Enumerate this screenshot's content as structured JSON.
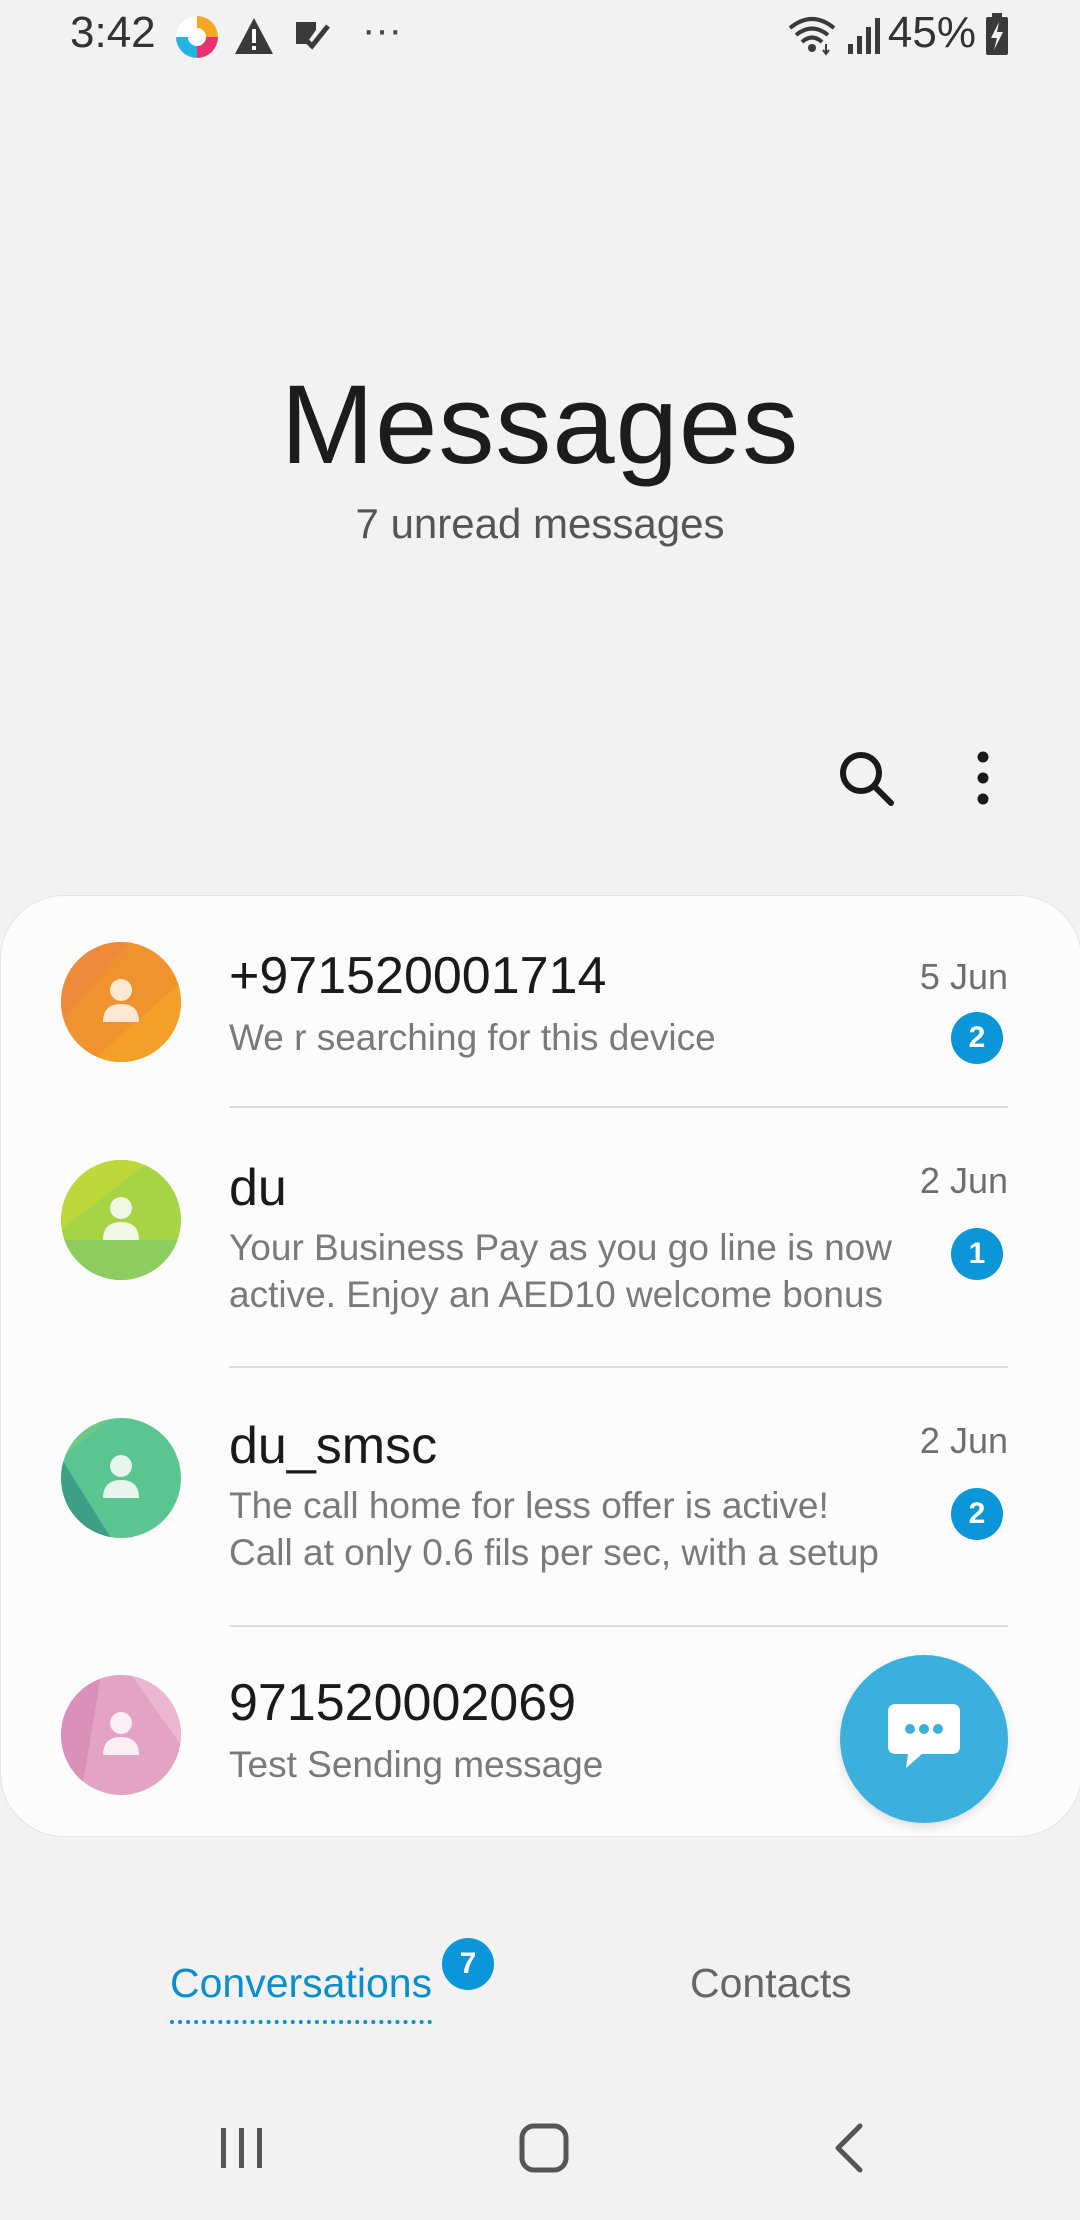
{
  "status_bar": {
    "time": "3:42",
    "battery": "45%",
    "overflow": "···",
    "icons": [
      "app-notification-icon",
      "warning-icon",
      "task-check-icon",
      "wifi-icon",
      "signal-icon",
      "battery-charging-icon"
    ]
  },
  "header": {
    "title": "Messages",
    "subtitle": "7 unread messages"
  },
  "toolbar": {
    "icons": [
      "search-icon",
      "more-options-icon"
    ]
  },
  "conversations": [
    {
      "name": "+971520001714",
      "preview_lines": [
        "We r searching for this device"
      ],
      "date": "5 Jun",
      "unread": "2",
      "avatar_color": "#f0922e"
    },
    {
      "name": "du",
      "preview_lines": [
        "Your Business Pay as you go line is now",
        "active. Enjoy an AED10 welcome bonus"
      ],
      "date": "2 Jun",
      "unread": "1",
      "avatar_color": "#a6d444"
    },
    {
      "name": "du_smsc",
      "preview_lines": [
        "The call home for less offer is active!",
        "Call at only 0.6 fils per sec, with a setup"
      ],
      "date": "2 Jun",
      "unread": "2",
      "avatar_color": "#5bc591"
    },
    {
      "name": "971520002069",
      "preview_lines": [
        "Test Sending message"
      ],
      "avatar_color": "#e4a2c4"
    }
  ],
  "fab": {
    "icon": "compose-message-icon"
  },
  "tabs": [
    {
      "label": "Conversations",
      "badge": "7",
      "active": true
    },
    {
      "label": "Contacts",
      "active": false
    }
  ],
  "nav_bar": {
    "icons": [
      "recent-apps-icon",
      "home-icon",
      "back-icon"
    ]
  },
  "colors": {
    "accent": "#0a96d8",
    "fab": "#3cb0dc",
    "background": "#f2f2f2"
  }
}
